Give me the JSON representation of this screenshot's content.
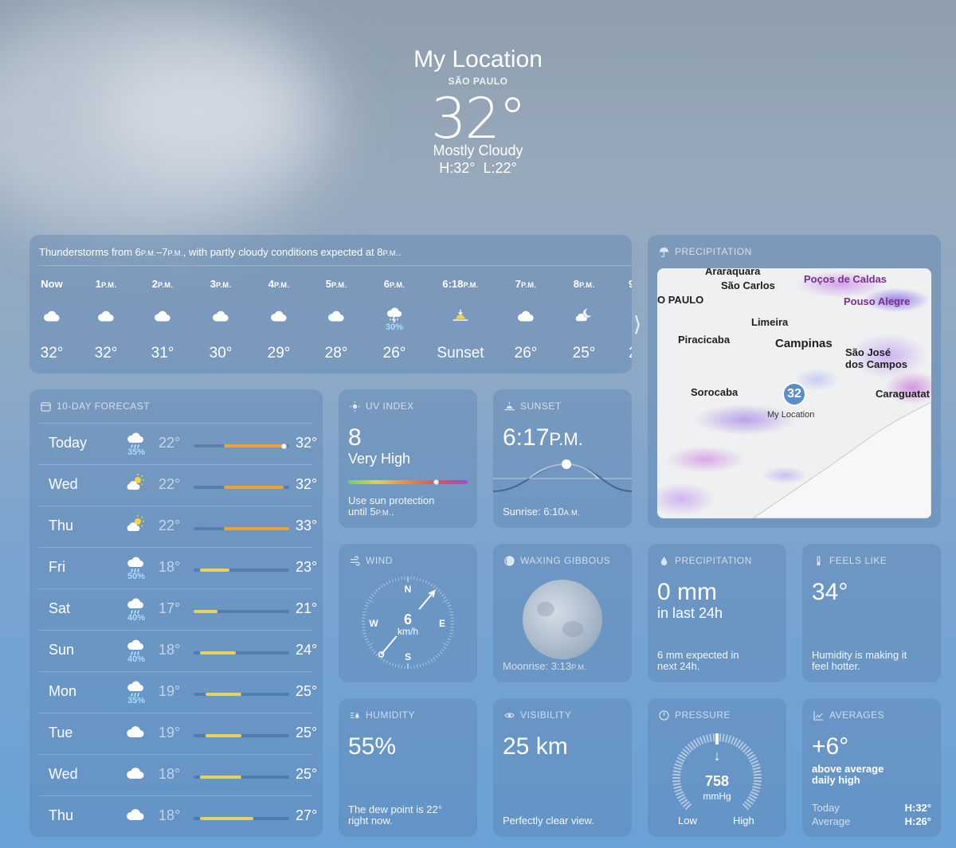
{
  "header": {
    "location": "My Location",
    "city": "SÃO PAULO",
    "temperature": "32°",
    "condition": "Mostly Cloudy",
    "hi": "H:32°",
    "lo": "L:22°"
  },
  "hourly": {
    "summary_parts": [
      "Thunderstorms from 6",
      "P.M.",
      "–7",
      "P.M.",
      ", with partly cloudy conditions expected at 8",
      "P.M.",
      "."
    ],
    "hours": [
      {
        "time": "Now",
        "icon": "cloud-icon",
        "temp": "32°"
      },
      {
        "time": "1",
        "ampm": "P.M.",
        "icon": "cloud-icon",
        "temp": "32°"
      },
      {
        "time": "2",
        "ampm": "P.M.",
        "icon": "cloud-icon",
        "temp": "31°"
      },
      {
        "time": "3",
        "ampm": "P.M.",
        "icon": "cloud-icon",
        "temp": "30°"
      },
      {
        "time": "4",
        "ampm": "P.M.",
        "icon": "cloud-icon",
        "temp": "29°"
      },
      {
        "time": "5",
        "ampm": "P.M.",
        "icon": "cloud-icon",
        "temp": "28°"
      },
      {
        "time": "6",
        "ampm": "P.M.",
        "icon": "thunderstorm-icon",
        "precip": "30%",
        "temp": "26°"
      },
      {
        "time": "6:18",
        "ampm": "P.M.",
        "icon": "sunset-icon",
        "temp": "Sunset"
      },
      {
        "time": "7",
        "ampm": "P.M.",
        "icon": "cloud-icon",
        "temp": "26°"
      },
      {
        "time": "8",
        "ampm": "P.M.",
        "icon": "partly-cloudy-night-icon",
        "temp": "25°"
      }
    ],
    "partial_hour": {
      "time": "9",
      "temp": "2"
    }
  },
  "forecast": {
    "title": "10-DAY FORECAST",
    "range": [
      17,
      33
    ],
    "days": [
      {
        "day": "Today",
        "icon": "rain-icon",
        "precip": "35%",
        "lo": "22°",
        "hi": "32°",
        "low": 22,
        "high": 32,
        "current": 32,
        "color": "#f0a030"
      },
      {
        "day": "Wed",
        "icon": "partly-sunny-icon",
        "lo": "22°",
        "hi": "32°",
        "low": 22,
        "high": 32,
        "color": "#f0a030"
      },
      {
        "day": "Thu",
        "icon": "partly-sunny-icon",
        "lo": "22°",
        "hi": "33°",
        "low": 22,
        "high": 33,
        "color": "#f0a030"
      },
      {
        "day": "Fri",
        "icon": "rain-icon",
        "precip": "50%",
        "lo": "18°",
        "hi": "23°",
        "low": 18,
        "high": 23,
        "color": "#e7d35a"
      },
      {
        "day": "Sat",
        "icon": "rain-icon",
        "precip": "40%",
        "lo": "17°",
        "hi": "21°",
        "low": 17,
        "high": 21,
        "color": "#e7d35a"
      },
      {
        "day": "Sun",
        "icon": "rain-icon",
        "precip": "40%",
        "lo": "18°",
        "hi": "24°",
        "low": 18,
        "high": 24,
        "color": "#e7d35a"
      },
      {
        "day": "Mon",
        "icon": "rain-icon",
        "precip": "35%",
        "lo": "19°",
        "hi": "25°",
        "low": 19,
        "high": 25,
        "color": "#e7d35a"
      },
      {
        "day": "Tue",
        "icon": "cloud-icon",
        "lo": "19°",
        "hi": "25°",
        "low": 19,
        "high": 25,
        "color": "#e7d35a"
      },
      {
        "day": "Wed",
        "icon": "cloud-icon",
        "lo": "18°",
        "hi": "25°",
        "low": 18,
        "high": 25,
        "color": "#e7d35a"
      },
      {
        "day": "Thu",
        "icon": "cloud-icon",
        "lo": "18°",
        "hi": "27°",
        "low": 18,
        "high": 27,
        "color": "#e7d35a"
      }
    ]
  },
  "uv": {
    "title": "UV INDEX",
    "value": "8",
    "level": "Very High",
    "note1": "Use sun protection",
    "note2_pre": "until 5",
    "note2_ampm": "P.M.",
    "fraction": 0.73
  },
  "sunset": {
    "title": "SUNSET",
    "time": "6:17",
    "ampm": "P.M.",
    "sunrise_pre": "Sunrise: 6:10",
    "sunrise_ampm": "A.M."
  },
  "precip_map": {
    "title": "PRECIPITATION",
    "marker": "32",
    "marker_label": "My Location",
    "places": [
      "Araraquara",
      "São Carlos",
      "Poços de Caldas",
      "O PAULO",
      "Pouso Alegre",
      "Limeira",
      "Piracicaba",
      "Campinas",
      "São José",
      "dos Campos",
      "Sorocaba",
      "Caraguatat"
    ]
  },
  "wind": {
    "title": "WIND",
    "speed": "6",
    "unit": "km/h",
    "n": "N",
    "e": "E",
    "s": "S",
    "w": "W",
    "direction_deg": 40
  },
  "moon": {
    "title": "WAXING GIBBOUS",
    "rise_pre": "Moonrise: 3:13",
    "rise_ampm": "P.M."
  },
  "precipitation": {
    "title": "PRECIPITATION",
    "value": "0 mm",
    "period": "in last 24h",
    "note1": "6 mm expected in",
    "note2": "next 24h."
  },
  "feels": {
    "title": "FEELS LIKE",
    "value": "34°",
    "note1": "Humidity is making it",
    "note2": "feel hotter."
  },
  "humidity": {
    "title": "HUMIDITY",
    "value": "55%",
    "note1": "The dew point is 22°",
    "note2": "right now."
  },
  "visibility": {
    "title": "VISIBILITY",
    "value": "25 km",
    "note": "Perfectly clear view."
  },
  "pressure": {
    "title": "PRESSURE",
    "value": "758",
    "unit": "mmHg",
    "low": "Low",
    "high": "High",
    "arrow": "↓"
  },
  "averages": {
    "title": "AVERAGES",
    "value": "+6°",
    "note1": "above average",
    "note2": "daily high",
    "today_label": "Today",
    "today_val": "H:32°",
    "avg_label": "Average",
    "avg_val": "H:26°"
  }
}
